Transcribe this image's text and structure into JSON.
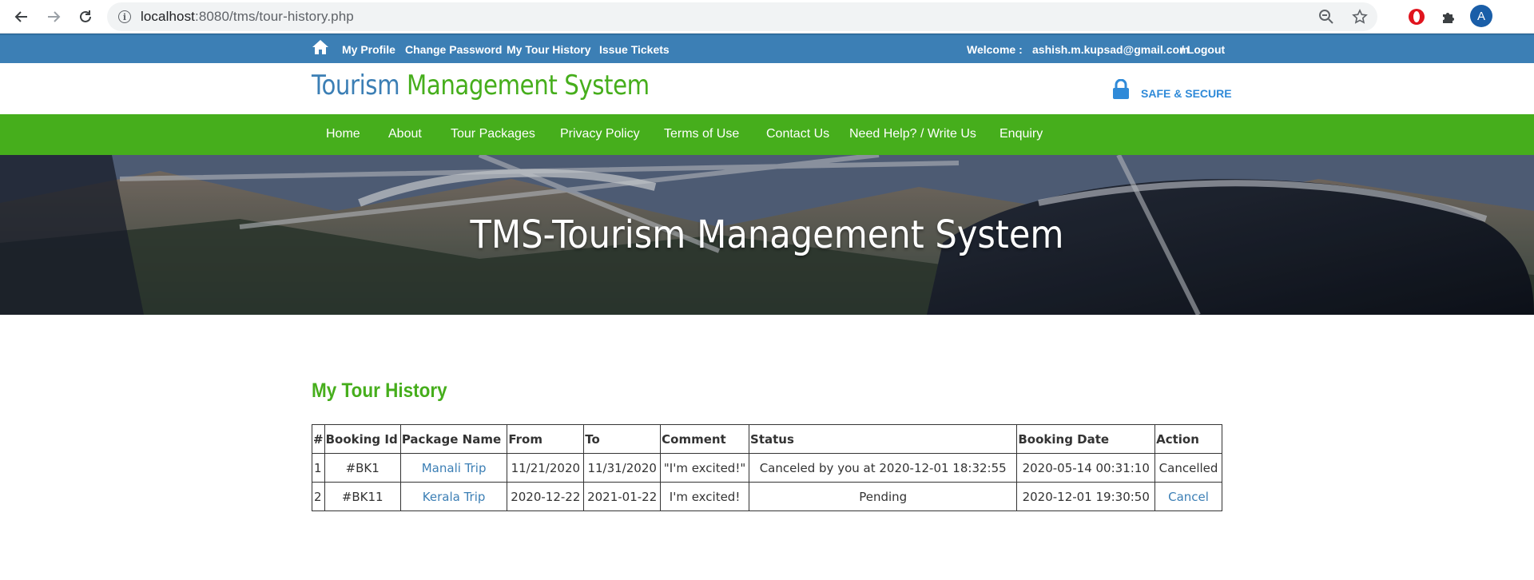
{
  "browser": {
    "url_host": "localhost",
    "url_path": ":8080/tms/tour-history.php",
    "avatar_letter": "A"
  },
  "topbar": {
    "links": [
      "My Profile",
      "Change Password",
      "My Tour History",
      "Issue Tickets"
    ],
    "welcome_label": "Welcome :",
    "user_email": "ashish.m.kupsad@gmail.com",
    "logout_label": "/ Logout"
  },
  "header": {
    "title_part1": "Tourism ",
    "title_part2": "Management System",
    "safe_label": "SAFE & SECURE"
  },
  "nav": {
    "items": [
      "Home",
      "About",
      "Tour Packages",
      "Privacy Policy",
      "Terms of Use",
      "Contact Us",
      "Need Help?  / Write Us",
      "Enquiry"
    ]
  },
  "banner": {
    "title": "TMS-Tourism Management System"
  },
  "history": {
    "title": "My Tour History",
    "columns": [
      "#",
      "Booking Id",
      "Package Name",
      "From",
      "To",
      "Comment",
      "Status",
      "Booking Date",
      "Action"
    ],
    "rows": [
      {
        "num": "1",
        "booking_id": "#BK1",
        "package": "Manali Trip",
        "from": "11/21/2020",
        "to": "11/31/2020",
        "comment": "\"I'm excited!\"",
        "status": "Canceled by you at 2020-12-01 18:32:55",
        "booking_date": "2020-05-14 00:31:10",
        "action": "Cancelled"
      },
      {
        "num": "2",
        "booking_id": "#BK11",
        "package": "Kerala Trip",
        "from": "2020-12-22",
        "to": "2021-01-22",
        "comment": "I'm excited!",
        "status": "Pending",
        "booking_date": "2020-12-01 19:30:50",
        "action": "Cancel"
      }
    ]
  },
  "colors": {
    "blue": "#3c7fb5",
    "green": "#46ae1c",
    "safe_blue": "#2f8ad8"
  },
  "icons": {
    "back": "arrow-left-icon",
    "forward": "arrow-right-icon",
    "reload": "reload-icon",
    "info": "info-icon",
    "zoom": "zoom-out-icon",
    "star": "star-icon",
    "opera": "opera-icon",
    "extensions": "puzzle-icon",
    "home": "home-icon",
    "lock": "lock-icon"
  }
}
